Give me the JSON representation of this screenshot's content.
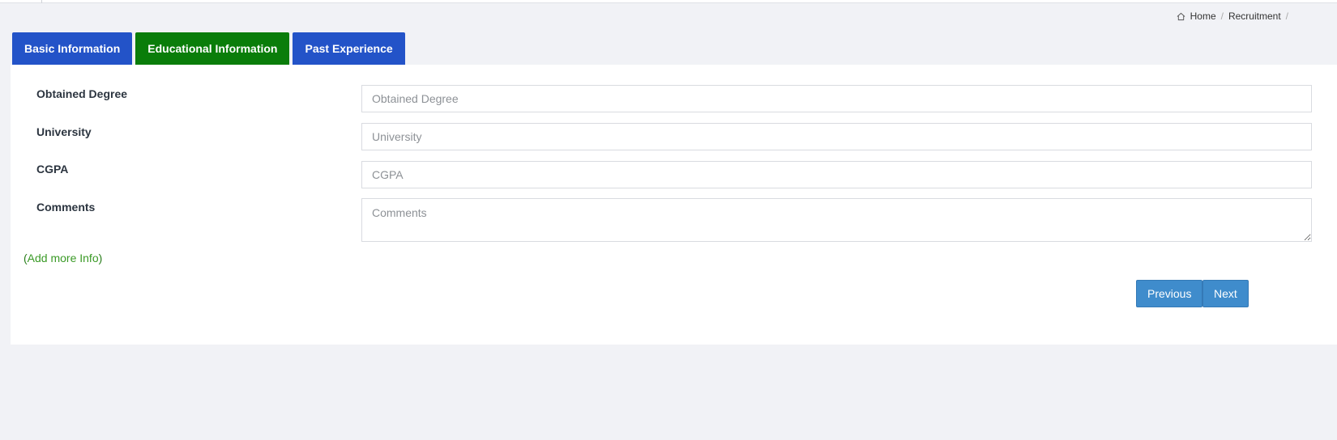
{
  "breadcrumb": {
    "items": [
      "Home",
      "Recruitment"
    ],
    "separator": "/"
  },
  "tabs": [
    {
      "label": "Basic Information",
      "color": "#2353c8"
    },
    {
      "label": "Educational Information",
      "color": "#0a7d0a",
      "active": true
    },
    {
      "label": "Past Experience",
      "color": "#2353c8"
    }
  ],
  "form": {
    "fields": [
      {
        "label": "Obtained Degree",
        "placeholder": "Obtained Degree",
        "value": ""
      },
      {
        "label": "University",
        "placeholder": "University",
        "value": ""
      },
      {
        "label": "CGPA",
        "placeholder": "CGPA",
        "value": ""
      },
      {
        "label": "Comments",
        "placeholder": "Comments",
        "value": ""
      }
    ],
    "add_more": {
      "open": "(",
      "link": "Add more Info",
      "close": ")"
    }
  },
  "actions": {
    "previous": "Previous",
    "next": "Next"
  },
  "icons": {
    "home": "home-icon"
  },
  "colors": {
    "tab_blue": "#2353c8",
    "tab_green": "#0a7d0a",
    "button": "#3f8ccc",
    "link_green": "#3a9a26",
    "background": "#f1f2f6"
  }
}
